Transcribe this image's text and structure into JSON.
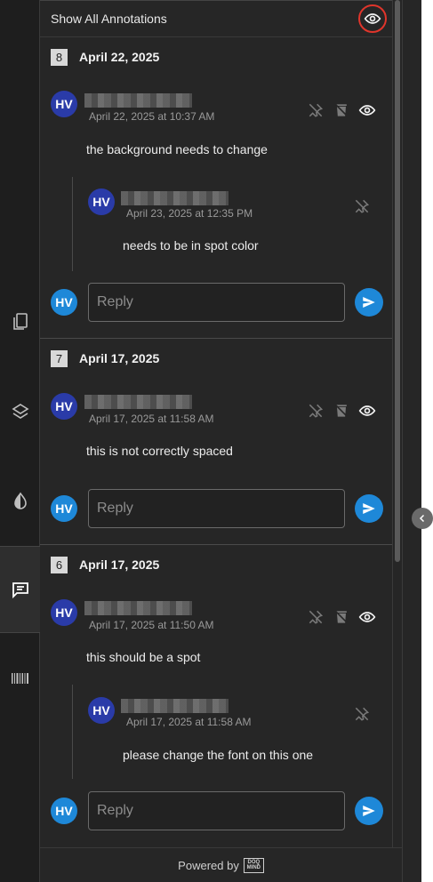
{
  "header": {
    "title": "Show All Annotations",
    "toggle_icon": "eye-icon",
    "toggle_ring_color": "#e0352b"
  },
  "groups": [
    {
      "number": "8",
      "date": "April 22, 2025",
      "comment": {
        "initials": "HV",
        "timestamp": "April 22, 2025 at 10:37 AM",
        "text": "the background needs to change"
      },
      "reply": {
        "initials": "HV",
        "timestamp": "April 23, 2025 at 12:35 PM",
        "text": "needs to be in spot color"
      },
      "reply_initials": "HV",
      "reply_placeholder": "Reply"
    },
    {
      "number": "7",
      "date": "April 17, 2025",
      "comment": {
        "initials": "HV",
        "timestamp": "April 17, 2025 at 11:58 AM",
        "text": "this is not correctly spaced"
      },
      "reply_initials": "HV",
      "reply_placeholder": "Reply"
    },
    {
      "number": "6",
      "date": "April 17, 2025",
      "comment": {
        "initials": "HV",
        "timestamp": "April 17, 2025 at 11:50 AM",
        "text": "this should be a spot"
      },
      "reply": {
        "initials": "HV",
        "timestamp": "April 17, 2025 at 11:58 AM",
        "text": "please change the font on this one"
      },
      "reply_initials": "HV",
      "reply_placeholder": "Reply"
    }
  ],
  "footer": {
    "powered_by": "Powered by",
    "logo_line1": "DOQ",
    "logo_line2": "MIND"
  },
  "colors": {
    "avatar_dark": "#2a3ba8",
    "avatar_light": "#1e88d8",
    "send": "#1e88d8"
  },
  "rail": [
    "pages-icon",
    "layers-icon",
    "color-separation-icon",
    "comments-icon",
    "barcode-icon"
  ]
}
